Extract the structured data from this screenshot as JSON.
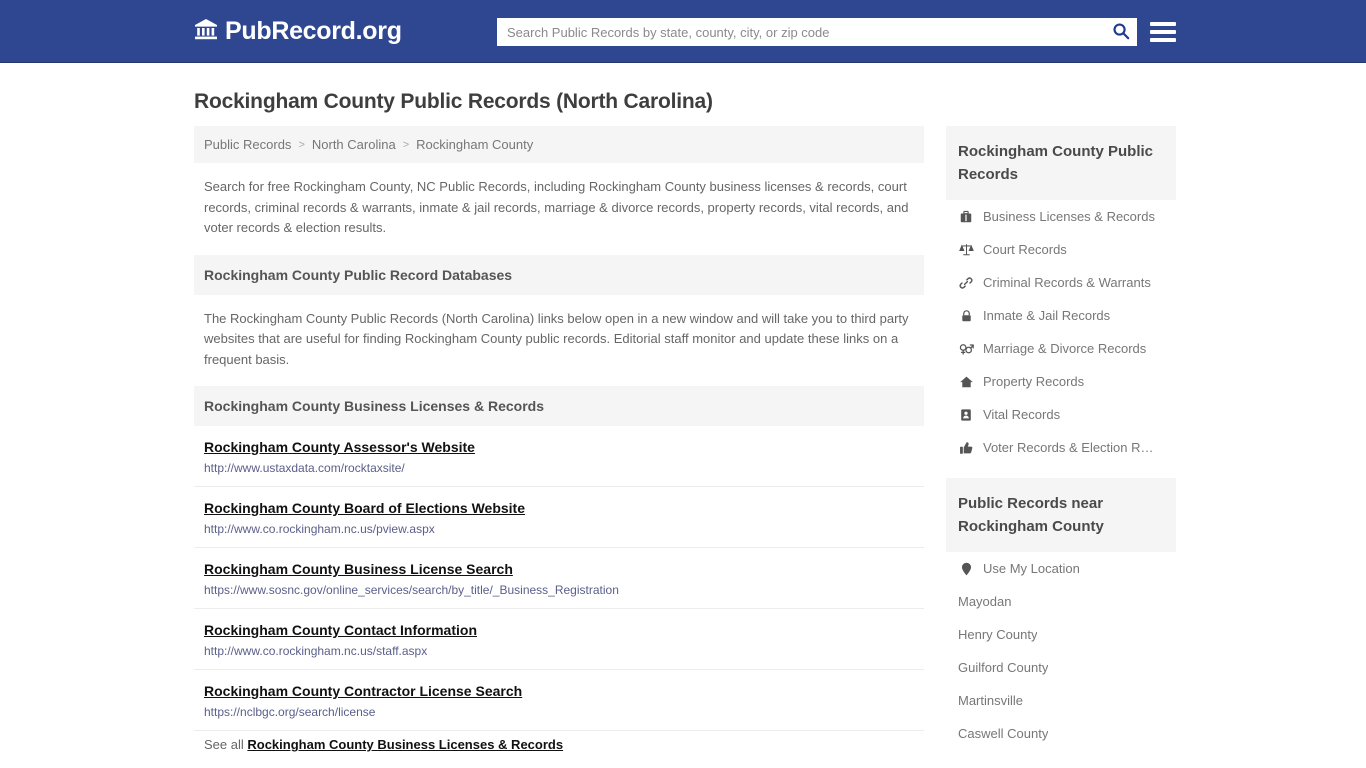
{
  "header": {
    "brand_name": "PubRecord.org",
    "brand_icon": "bank-building-icon",
    "search_placeholder": "Search Public Records by state, county, city, or zip code",
    "search_value": "",
    "search_icon": "search-icon",
    "menu_icon": "hamburger-menu-icon",
    "bg_color": "#2f4791"
  },
  "page": {
    "title": "Rockingham County Public Records (North Carolina)"
  },
  "breadcrumb": {
    "items": [
      {
        "label": "Public Records"
      },
      {
        "label": "North Carolina"
      },
      {
        "label": "Rockingham County"
      }
    ],
    "separator": ">"
  },
  "intro": {
    "text": "Search for free Rockingham County, NC Public Records, including Rockingham County business licenses & records, court records, criminal records & warrants, inmate & jail records, marriage & divorce records, property records, vital records, and voter records & election results."
  },
  "databases_section": {
    "heading": "Rockingham County Public Record Databases",
    "text": "The Rockingham County Public Records (North Carolina) links below open in a new window and will take you to third party websites that are useful for finding Rockingham County public records. Editorial staff monitor and update these links on a frequent basis."
  },
  "business_section": {
    "heading": "Rockingham County Business Licenses & Records",
    "links": [
      {
        "title": "Rockingham County Assessor's Website",
        "url": "http://www.ustaxdata.com/rocktaxsite/"
      },
      {
        "title": "Rockingham County Board of Elections Website",
        "url": "http://www.co.rockingham.nc.us/pview.aspx"
      },
      {
        "title": "Rockingham County Business License Search",
        "url": "https://www.sosnc.gov/online_services/search/by_title/_Business_Registration"
      },
      {
        "title": "Rockingham County Contact Information",
        "url": "http://www.co.rockingham.nc.us/staff.aspx"
      },
      {
        "title": "Rockingham County Contractor License Search",
        "url": "https://nclbgc.org/search/license"
      }
    ],
    "see_all_prefix": "See all",
    "see_all_link": "Rockingham County Business Licenses & Records"
  },
  "sidebar": {
    "records_panel": {
      "heading": "Rockingham County Public Records",
      "items": [
        {
          "label": "Business Licenses & Records",
          "icon": "briefcase-icon"
        },
        {
          "label": "Court Records",
          "icon": "scales-of-justice-icon"
        },
        {
          "label": "Criminal Records & Warrants",
          "icon": "chain-link-icon"
        },
        {
          "label": "Inmate & Jail Records",
          "icon": "lock-icon"
        },
        {
          "label": "Marriage & Divorce Records",
          "icon": "venus-mars-icon"
        },
        {
          "label": "Property Records",
          "icon": "home-icon"
        },
        {
          "label": "Vital Records",
          "icon": "id-card-icon"
        },
        {
          "label": "Voter Records & Election R…",
          "icon": "thumbs-up-icon"
        }
      ]
    },
    "nearby_panel": {
      "heading": "Public Records near Rockingham County",
      "items": [
        {
          "label": "Use My Location",
          "icon": "map-pin-icon"
        },
        {
          "label": "Mayodan",
          "icon": ""
        },
        {
          "label": "Henry County",
          "icon": ""
        },
        {
          "label": "Guilford County",
          "icon": ""
        },
        {
          "label": "Martinsville",
          "icon": ""
        },
        {
          "label": "Caswell County",
          "icon": ""
        }
      ]
    }
  }
}
